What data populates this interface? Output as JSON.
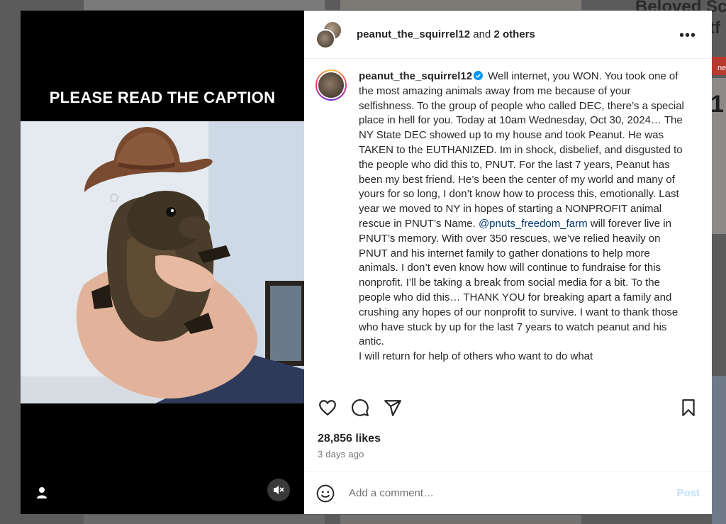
{
  "background": {
    "heading_line1": "Beloved Sc",
    "heading_line2": "tf",
    "badge": "ne",
    "number": "1"
  },
  "media": {
    "caption_overlay": "PLEASE READ THE CAPTION",
    "user_icon": "user-icon",
    "mute_icon": "speaker-muted-icon"
  },
  "header": {
    "owner": "peanut_the_squirrel12",
    "joiner": " and ",
    "others": "2 others",
    "more": "•••"
  },
  "caption": {
    "username": "peanut_the_squirrel12",
    "part1": "Well internet, you WON. You took one of the most amazing animals away from me because of your selfishness. To the group of people who called DEC, there’s a special place in hell for you. Today at 10am Wednesday, Oct 30, 2024… The NY State DEC showed up to my house and took Peanut. He was TAKEN to the EUTHANIZED. Im in shock, disbelief, and disgusted to the people who did this to, PNUT. For the last 7 years, Peanut has been my best friend. He’s been the center of my world and many of yours for so long, I don’t know how to process this, emotionally. Last year we moved to NY in hopes of starting a NONPROFIT animal rescue in PNUT’s Name. ",
    "mention": "@pnuts_freedom_farm",
    "part2": " will forever live in PNUT’s memory. With over 350 rescues, we’ve relied heavily on PNUT and his internet family to gather donations to help more animals. I don’t even know how will continue to fundraise for this nonprofit. I’ll be taking a break from social media for a bit. To the people who did this… THANK YOU for breaking apart a family and crushing any hopes of our nonprofit to survive. I want to thank those who have stuck by up for the last 7 years to watch peanut and his antic.",
    "part3": "I will return for help of others who want to do what"
  },
  "actions": {
    "like_icon": "heart-icon",
    "comment_icon": "comment-icon",
    "share_icon": "send-icon",
    "save_icon": "bookmark-icon"
  },
  "stats": {
    "likes": "28,856 likes",
    "time": "3 days ago"
  },
  "comment": {
    "placeholder": "Add a comment…",
    "post_label": "Post",
    "emoji_icon": "emoji-icon"
  },
  "colors": {
    "mention": "#00376b",
    "post_disabled": "#c0dffd",
    "verified": "#0095f6"
  }
}
